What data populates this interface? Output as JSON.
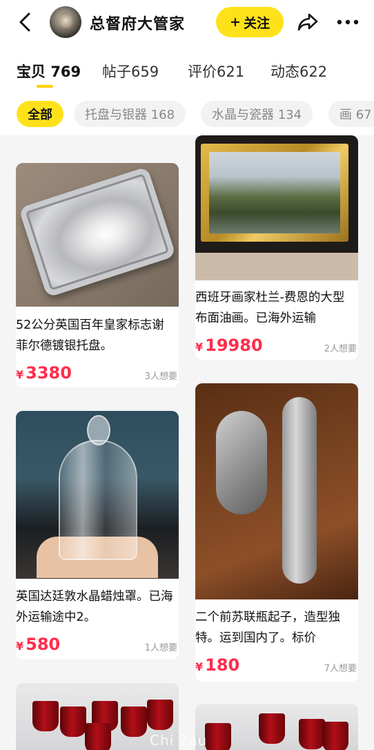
{
  "header": {
    "shop_name": "总督府大管家",
    "follow_label": "关注",
    "follow_prefix": "+"
  },
  "tabs": [
    {
      "label": "宝贝",
      "count": "769",
      "active": true
    },
    {
      "label": "帖子",
      "count": "659",
      "active": false
    },
    {
      "label": "评价",
      "count": "621",
      "active": false
    },
    {
      "label": "动态",
      "count": "622",
      "active": false
    }
  ],
  "categories": [
    {
      "label": "全部",
      "active": true
    },
    {
      "label": "托盘与银器 168",
      "active": false
    },
    {
      "label": "水晶与瓷器 134",
      "active": false
    },
    {
      "label": "画 67",
      "active": false
    }
  ],
  "items": [
    {
      "title": "52公分英国百年皇家标志谢菲尔德镀银托盘。",
      "currency": "¥",
      "price": "3380",
      "wants": "3人想要"
    },
    {
      "title": "西班牙画家杜兰-费恩的大型布面油画。已海外运输",
      "currency": "¥",
      "price": "19980",
      "wants": "2人想要"
    },
    {
      "title": "英国达廷敦水晶蜡烛罩。已海外运输途中2。",
      "currency": "¥",
      "price": "580",
      "wants": "1人想要"
    },
    {
      "title": "二个前苏联瓶起子，造型独特。运到国内了。标价",
      "currency": "¥",
      "price": "180",
      "wants": "7人想要"
    }
  ],
  "watermark": "Chi  2au",
  "colors": {
    "accent_yellow": "#ffe11a",
    "price_red": "#ff2d4b",
    "text_gray": "#999999"
  },
  "icons": [
    "back-arrow-icon",
    "share-icon",
    "more-icon"
  ]
}
